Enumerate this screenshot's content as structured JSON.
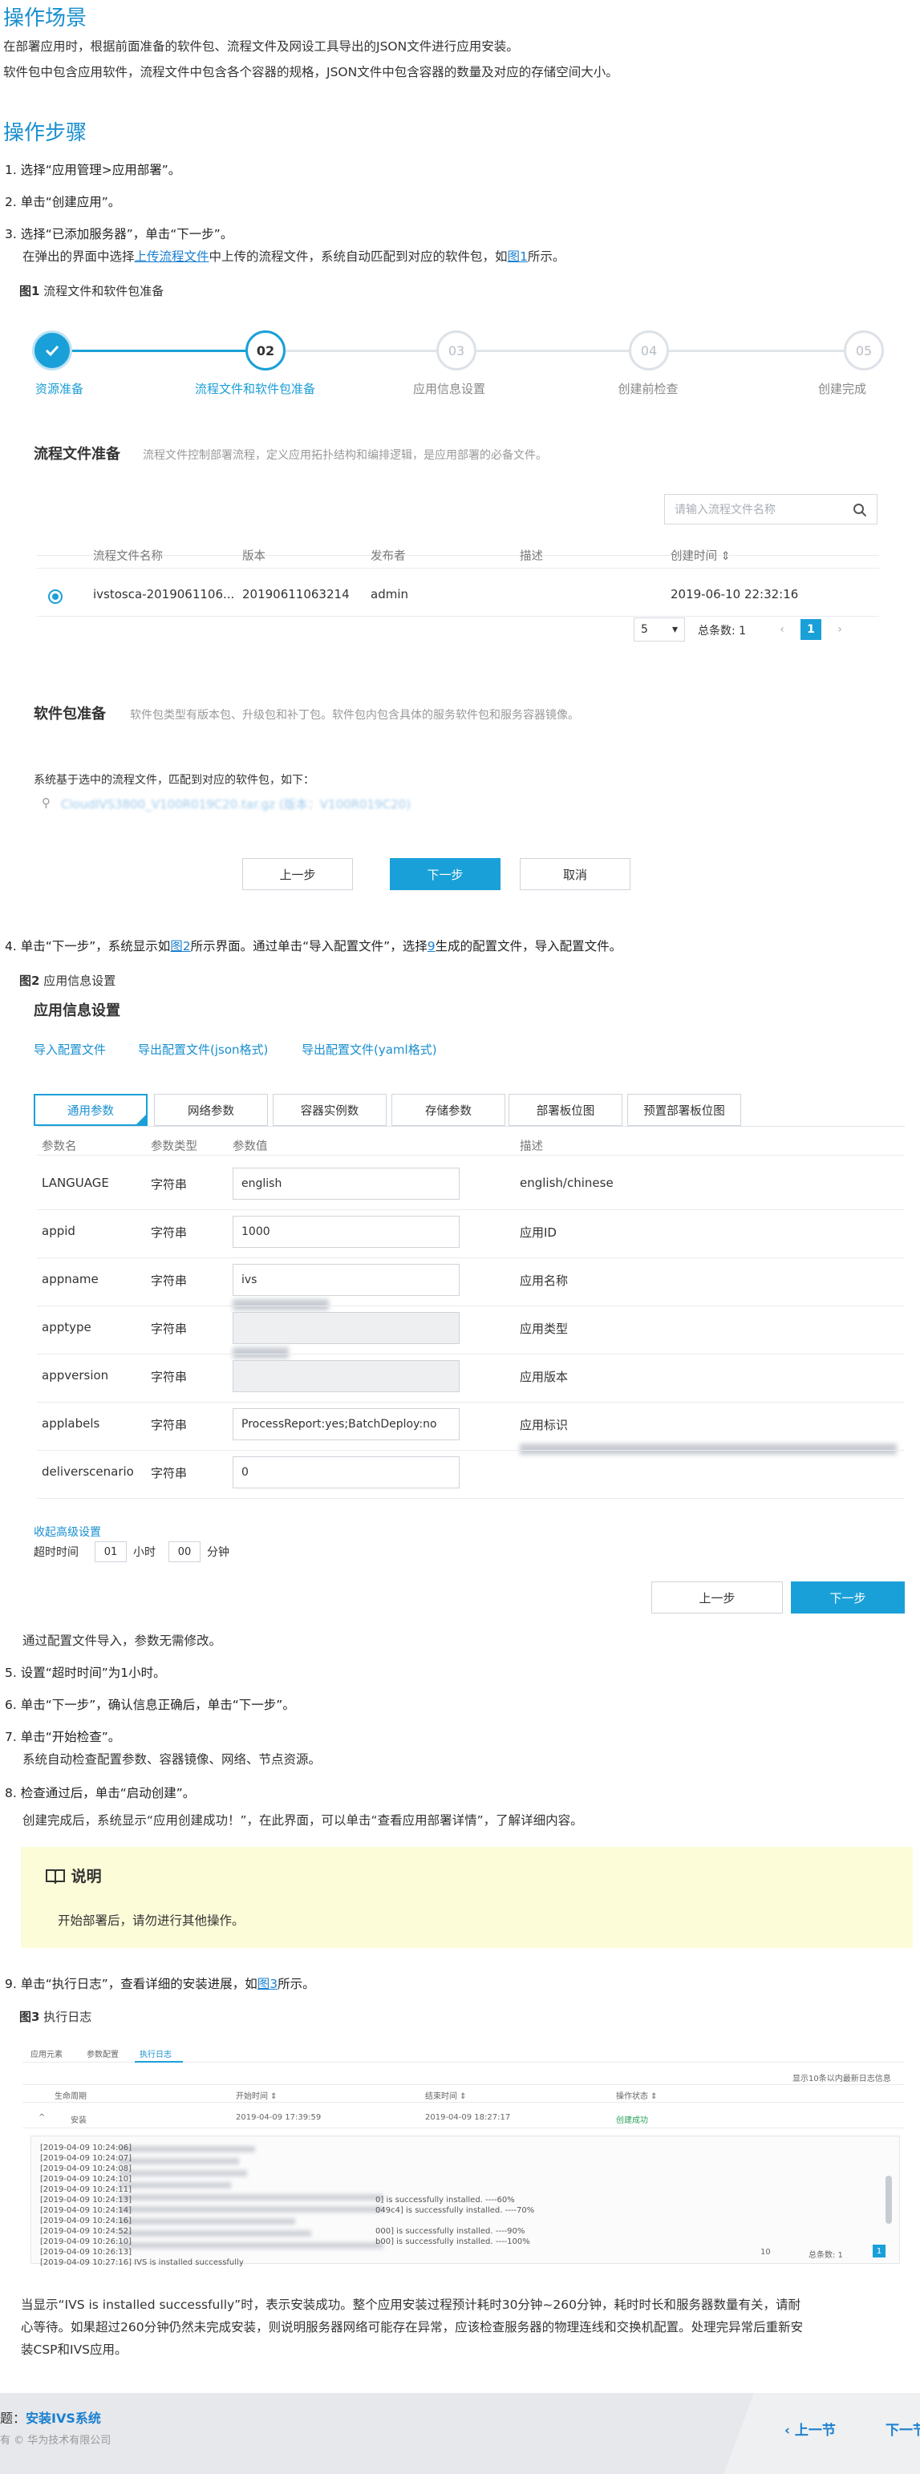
{
  "scene": {
    "title": "操作场景",
    "line1": "在部署应用时，根据前面准备的软件包、流程文件及网设工具导出的JSON文件进行应用安装。",
    "line2": "软件包中包含应用软件，流程文件中包含各个容器的规格，JSON文件中包含容器的数量及对应的存储空间大小。"
  },
  "steps_title": "操作步骤",
  "steps": {
    "s1": "1. 选择“应用管理>应用部署”。",
    "s2": "2. 单击“创建应用”。",
    "s3": "3. 选择“已添加服务器”，单击“下一步”。",
    "s3_sub_a": "在弹出的界面中选择",
    "s3_sub_link": "上传流程文件",
    "s3_sub_b": "中上传的流程文件，系统自动匹配到对应的软件包，如",
    "s3_sub_fig": "图1",
    "s3_sub_c": "所示。",
    "s4_a": "4. 单击“下一步”，系统显示如",
    "s4_fig": "图2",
    "s4_b": "所示界面。通过单击“导入配置文件”，选择",
    "s4_link": "9",
    "s4_c": "生成的配置文件，导入配置文件。",
    "s4_sub": "通过配置文件导入，参数无需修改。",
    "s5": "5. 设置“超时时间”为1小时。",
    "s6": "6. 单击“下一步”，确认信息正确后，单击“下一步”。",
    "s7": "7. 单击“开始检查”。",
    "s7_sub": "系统自动检查配置参数、容器镜像、网络、节点资源。",
    "s8": "8. 检查通过后，单击“启动创建”。",
    "s8_sub": "创建完成后，系统显示“应用创建成功！”，在此界面，可以单击“查看应用部署详情”，了解详细内容。",
    "s9_a": "9. 单击“执行日志”，查看详细的安装进展，如",
    "s9_fig": "图3",
    "s9_b": "所示。"
  },
  "fig1": {
    "caption_num": "图1",
    "caption": "流程文件和软件包准备",
    "stepper": [
      {
        "num": "",
        "label": "资源准备"
      },
      {
        "num": "02",
        "label": "流程文件和软件包准备"
      },
      {
        "num": "03",
        "label": "应用信息设置"
      },
      {
        "num": "04",
        "label": "创建前检查"
      },
      {
        "num": "05",
        "label": "创建完成"
      }
    ],
    "flow_title": "流程文件准备",
    "flow_desc": "流程文件控制部署流程，定义应用拓扑结构和编排逻辑，是应用部署的必备文件。",
    "search_placeholder": "请输入流程文件名称",
    "headers": [
      "流程文件名称",
      "版本",
      "发布者",
      "描述",
      "创建时间 ⇕"
    ],
    "row": {
      "name": "ivstosca-2019061106...",
      "version": "20190611063214",
      "publisher": "admin",
      "created": "2019-06-10 22:32:16"
    },
    "pager_size": "5",
    "pager_total": "总条数: 1",
    "pager_page": "1",
    "pkg_title": "软件包准备",
    "pkg_desc": "软件包类型有版本包、升级包和补丁包。软件包内包含具体的服务软件包和服务容器镜像。",
    "match_text": "系统基于选中的流程文件，匹配到对应的软件包，如下：",
    "pkg_file": "CloudIVS3800_V100R019C20.tar.gz (版本：V100R019C20)",
    "btn_prev": "上一步",
    "btn_next": "下一步",
    "btn_cancel": "取消"
  },
  "fig2": {
    "caption_num": "图2",
    "caption": "应用信息设置",
    "title": "应用信息设置",
    "links": [
      "导入配置文件",
      "导出配置文件(json格式)",
      "导出配置文件(yaml格式)"
    ],
    "tabs": [
      "通用参数",
      "网络参数",
      "容器实例数",
      "存储参数",
      "部署板位图",
      "预置部署板位图"
    ],
    "headers": [
      "参数名",
      "参数类型",
      "参数值",
      "描述"
    ],
    "rows": [
      {
        "name": "LANGUAGE",
        "type": "字符串",
        "value": "english",
        "desc": "english/chinese",
        "disabled": false
      },
      {
        "name": "appid",
        "type": "字符串",
        "value": "1000",
        "desc": "应用ID",
        "disabled": false
      },
      {
        "name": "appname",
        "type": "字符串",
        "value": "ivs",
        "desc": "应用名称",
        "disabled": false
      },
      {
        "name": "apptype",
        "type": "字符串",
        "value": "",
        "desc": "应用类型",
        "disabled": true
      },
      {
        "name": "appversion",
        "type": "字符串",
        "value": "",
        "desc": "应用版本",
        "disabled": true
      },
      {
        "name": "applabels",
        "type": "字符串",
        "value": "ProcessReport:yes;BatchDeploy:no",
        "desc": "应用标识",
        "disabled": false
      },
      {
        "name": "deliverscenario",
        "type": "字符串",
        "value": "0",
        "desc": "",
        "disabled": false
      }
    ],
    "collapse_link": "收起高级设置",
    "timeout_label": "超时时间",
    "timeout_hours": "01",
    "hours_unit": "小时",
    "timeout_minutes": "00",
    "minutes_unit": "分钟",
    "btn_prev": "上一步",
    "btn_next": "下一步"
  },
  "note": {
    "title": "说明",
    "body": "开始部署后，请勿进行其他操作。"
  },
  "fig3": {
    "caption_num": "图3",
    "caption": "执行日志",
    "tabs": [
      "应用元素",
      "参数配置",
      "执行日志"
    ],
    "top_right": "显示10条以内最新日志信息",
    "headers": [
      "生命周期",
      "开始时间 ⇕",
      "结束时间 ⇕",
      "操作状态 ⇕"
    ],
    "row": {
      "phase": "安装",
      "start": "2019-04-09 17:39:59",
      "end": "2019-04-09 18:27:17",
      "status": "创建成功"
    },
    "logs": [
      "[2019-04-09 10:24:06]",
      "[2019-04-09 10:24:07]",
      "[2019-04-09 10:24:08]",
      "[2019-04-09 10:24:10]",
      "[2019-04-09 10:24:11]",
      "[2019-04-09 10:24:13]",
      "[2019-04-09 10:24:14]",
      "[2019-04-09 10:24:16]",
      "[2019-04-09 10:24:52]",
      "[2019-04-09 10:26:10]",
      "[2019-04-09 10:26:13]",
      "[2019-04-09 10:27:16] IVS is installed successfully"
    ],
    "log_tails": [
      "0] is successfully installed. ----60%",
      "049c4] is successfully installed. ----70%",
      "000] is successfully installed. ----90%",
      "b00] is successfully installed. ----100%"
    ],
    "pager_size": "10",
    "pager_total": "总条数: 1",
    "pager_page": "1"
  },
  "result": {
    "line1": "当显示“IVS is installed successfully”时，表示安装成功。整个应用安装过程预计耗时30分钟~260分钟，耗时时长和服务器数量有关，请耐",
    "line2": "心等待。如果超过260分钟仍然未完成安装，则说明服务器网络可能存在异常，应该检查服务器的物理连线和交换机配置。处理完异常后重新安",
    "line3": "装CSP和IVS应用。"
  },
  "footer": {
    "prefix": "题：",
    "title": "安装IVS系统",
    "copyright": "有 © 华为技术有限公司",
    "prev": "‹ 上一节",
    "next": "下一节"
  }
}
